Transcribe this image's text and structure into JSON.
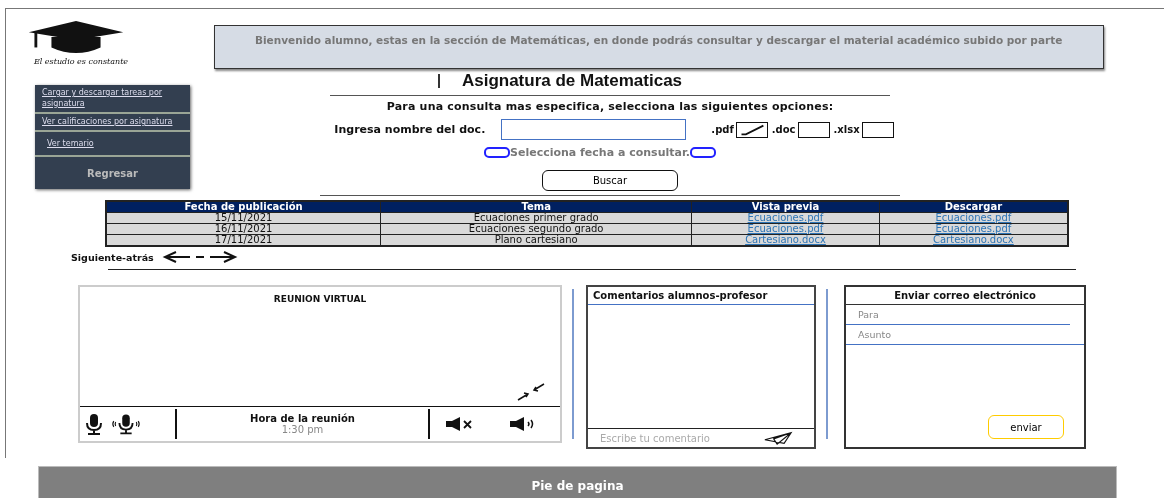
{
  "logo": {
    "tagline": "El estudio es constante"
  },
  "banner": "Bienvenido alumno, estas en la sección de Matemáticas, en donde podrás consultar y descargar el material académico subido por parte",
  "sidebar": {
    "items": [
      {
        "label": "Cargar y descargar tareas por asignatura",
        "kind": "link"
      },
      {
        "label": "Ver calificaciones por asignatura",
        "kind": "link"
      },
      {
        "label": "Ver temario",
        "kind": "link"
      },
      {
        "label": "Regresar",
        "kind": "button"
      }
    ]
  },
  "title": "Asignatura de Matematicas",
  "instructions": "Para una consulta mas especifica, selecciona las siguientes opciones:",
  "search": {
    "label": "Ingresa nombre del doc.",
    "formats": [
      {
        "label": ".pdf",
        "checked": true
      },
      {
        "label": ".doc",
        "checked": false
      },
      {
        "label": ".xlsx",
        "checked": false
      }
    ]
  },
  "date_picker": {
    "label": "Selecciona fecha a consultar."
  },
  "search_button": "Buscar",
  "table": {
    "columns": [
      "Fecha de publicación",
      "Tema",
      "Vista previa",
      "Descargar"
    ],
    "rows": [
      {
        "date": "15/11/2021",
        "topic": "Ecuaciones primer grado",
        "preview": "Ecuaciones.pdf",
        "download": "Ecuaciones.pdf"
      },
      {
        "date": "16/11/2021",
        "topic": "Ecuaciones segundo grado",
        "preview": "Ecuaciones.pdf",
        "download": "Ecuaciones.pdf"
      },
      {
        "date": "17/11/2021",
        "topic": "Plano cartesiano",
        "preview": "Cartesiano.docx",
        "download": "Cartesiano.docx"
      }
    ]
  },
  "pager": {
    "label": "Siguiente-atrás"
  },
  "meeting": {
    "title": "REUNION VIRTUAL",
    "time_label": "Hora de la reunión",
    "time": "1:30 pm"
  },
  "comments": {
    "title": "Comentarios alumnos-profesor",
    "placeholder": "Escribe tu comentario"
  },
  "email": {
    "title": "Enviar correo electrónico",
    "to_placeholder": "Para",
    "subject_placeholder": "Asunto",
    "send": "enviar"
  },
  "footer": "Pie de pagina"
}
